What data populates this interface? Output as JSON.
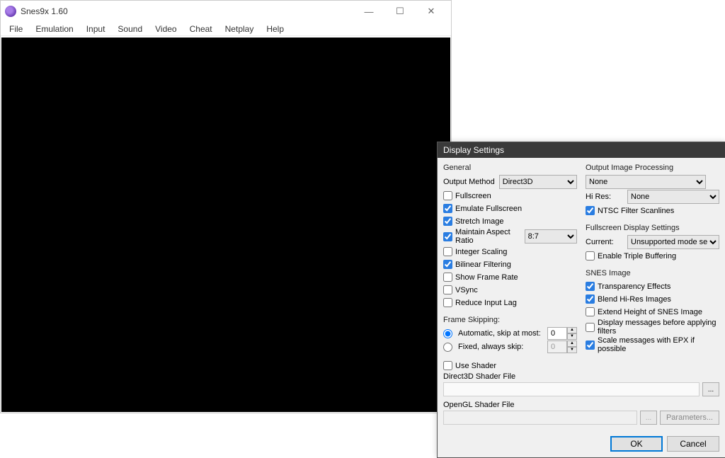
{
  "main_window": {
    "title": "Snes9x 1.60",
    "menu": [
      "File",
      "Emulation",
      "Input",
      "Sound",
      "Video",
      "Cheat",
      "Netplay",
      "Help"
    ]
  },
  "dialog": {
    "title": "Display Settings",
    "general": {
      "header": "General",
      "output_method_label": "Output Method",
      "output_method_value": "Direct3D",
      "fullscreen": {
        "label": "Fullscreen",
        "checked": false
      },
      "emulate_fullscreen": {
        "label": "Emulate Fullscreen",
        "checked": true
      },
      "stretch_image": {
        "label": "Stretch Image",
        "checked": true
      },
      "maintain_aspect": {
        "label": "Maintain Aspect Ratio",
        "checked": true,
        "ratio_value": "8:7"
      },
      "integer_scaling": {
        "label": "Integer Scaling",
        "checked": false
      },
      "bilinear_filtering": {
        "label": "Bilinear Filtering",
        "checked": true
      },
      "show_frame_rate": {
        "label": "Show Frame Rate",
        "checked": false
      },
      "vsync": {
        "label": "VSync",
        "checked": false
      },
      "reduce_input_lag": {
        "label": "Reduce Input Lag",
        "checked": false
      }
    },
    "frame_skipping": {
      "header": "Frame Skipping:",
      "automatic": {
        "label": "Automatic, skip at most:",
        "selected": true,
        "value": "0"
      },
      "fixed": {
        "label": "Fixed, always skip:",
        "selected": false,
        "value": "0"
      }
    },
    "output_processing": {
      "header": "Output Image Processing",
      "filter_value": "None",
      "hires_label": "Hi Res:",
      "hires_value": "None",
      "ntsc_scanlines": {
        "label": "NTSC Filter Scanlines",
        "checked": true
      }
    },
    "fullscreen_display": {
      "header": "Fullscreen Display Settings",
      "current_label": "Current:",
      "current_value": "Unsupported mode selected",
      "triple_buffering": {
        "label": "Enable Triple Buffering",
        "checked": false
      }
    },
    "snes_image": {
      "header": "SNES Image",
      "transparency": {
        "label": "Transparency Effects",
        "checked": true
      },
      "blend_hires": {
        "label": "Blend Hi-Res Images",
        "checked": true
      },
      "extend_height": {
        "label": "Extend Height of SNES Image",
        "checked": false
      },
      "display_messages": {
        "label": "Display messages before applying filters",
        "checked": false
      },
      "scale_messages": {
        "label": "Scale messages with EPX if possible",
        "checked": true
      }
    },
    "shader": {
      "use_shader": {
        "label": "Use Shader",
        "checked": false
      },
      "d3d_label": "Direct3D Shader File",
      "ogl_label": "OpenGL Shader File",
      "parameters_label": "Parameters..."
    },
    "buttons": {
      "ok": "OK",
      "cancel": "Cancel"
    }
  }
}
